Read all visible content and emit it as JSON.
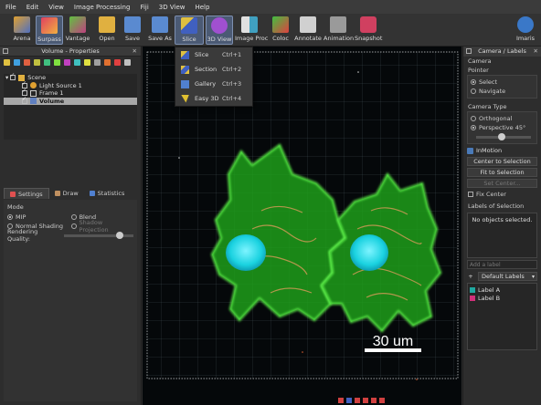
{
  "menu": [
    "File",
    "Edit",
    "View",
    "Image Processing",
    "Fiji",
    "3D View",
    "Help"
  ],
  "toolbar": {
    "buttons": [
      {
        "label": "Arena"
      },
      {
        "label": "Surpass"
      },
      {
        "label": "Vantage"
      },
      {
        "label": "Open"
      },
      {
        "label": "Save"
      },
      {
        "label": "Save As"
      },
      {
        "label": "Slice"
      },
      {
        "label": "3D View"
      },
      {
        "label": "Image Proc"
      },
      {
        "label": "Coloc"
      },
      {
        "label": "Annotate"
      },
      {
        "label": "Animation"
      },
      {
        "label": "Snapshot"
      },
      {
        "label": "Imaris"
      }
    ]
  },
  "view_menu": {
    "items": [
      {
        "label": "Slice",
        "shortcut": "Ctrl+1"
      },
      {
        "label": "Section",
        "shortcut": "Ctrl+2"
      },
      {
        "label": "Gallery",
        "shortcut": "Ctrl+3"
      },
      {
        "label": "Easy 3D",
        "shortcut": "Ctrl+4"
      }
    ]
  },
  "left_panel": {
    "title": "Volume - Properties",
    "tree": [
      {
        "label": "Scene"
      },
      {
        "label": "Light Source 1"
      },
      {
        "label": "Frame 1"
      },
      {
        "label": "Volume"
      }
    ],
    "tabs": [
      "Settings",
      "Draw",
      "Statistics"
    ],
    "mode_label": "Mode",
    "mode_options": [
      "MIP",
      "Blend",
      "Normal Shading",
      "Shadow Projection"
    ],
    "rendering_quality_label": "Rendering Quality:",
    "rendering_quality": 0.8
  },
  "viewer": {
    "scale_bar_label": "30 um",
    "colors": {
      "nucleus": "#1ad2e0",
      "actin": "#27c61f",
      "mito": "#d99a5a"
    }
  },
  "right_panel": {
    "title": "Camera / Labels",
    "camera_label": "Camera",
    "pointer_label": "Pointer",
    "pointer_options": [
      "Select",
      "Navigate"
    ],
    "camera_type_label": "Camera Type",
    "camera_type_options": [
      "Orthogonal",
      "Perspective 45°"
    ],
    "inmotion_label": "InMotion",
    "buttons": [
      "Center to Selection",
      "Fit to Selection",
      "Set Center..."
    ],
    "fix_center_label": "Fix Center",
    "labels_of_selection_label": "Labels of Selection",
    "no_objects_text": "No objects selected.",
    "add_label_placeholder": "Add a label",
    "plus": "+",
    "default_labels": "Default Labels",
    "labels": [
      {
        "name": "Label A",
        "color": "#1fa8a0"
      },
      {
        "name": "Label B",
        "color": "#d0307a"
      }
    ]
  }
}
